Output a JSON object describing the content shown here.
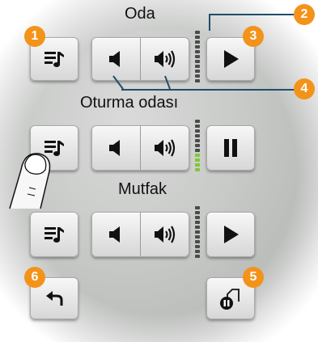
{
  "rooms": [
    {
      "name": "Oda",
      "state": "stopped"
    },
    {
      "name": "Oturma odası",
      "state": "playing"
    },
    {
      "name": "Mutfak",
      "state": "stopped"
    }
  ],
  "badges": [
    "1",
    "2",
    "3",
    "4",
    "5",
    "6"
  ],
  "colors": {
    "badge": "#f3931a",
    "meter_active": "#7fc832",
    "meter_idle": "#4b4b4b"
  },
  "icons": {
    "playlist": "playlist-icon",
    "volume_down": "volume-down-icon",
    "volume_up": "volume-up-icon",
    "play": "play-icon",
    "pause": "pause-icon",
    "back": "back-arrow-icon",
    "pause_all": "pause-all-icon"
  }
}
